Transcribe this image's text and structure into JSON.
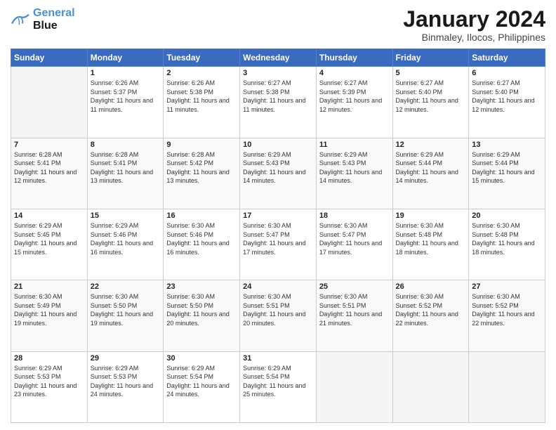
{
  "header": {
    "logo_line1": "General",
    "logo_line2": "Blue",
    "main_title": "January 2024",
    "subtitle": "Binmaley, Ilocos, Philippines"
  },
  "calendar": {
    "days_of_week": [
      "Sunday",
      "Monday",
      "Tuesday",
      "Wednesday",
      "Thursday",
      "Friday",
      "Saturday"
    ],
    "weeks": [
      [
        {
          "day": "",
          "empty": true
        },
        {
          "day": "1",
          "sunrise": "6:26 AM",
          "sunset": "5:37 PM",
          "daylight": "11 hours and 11 minutes."
        },
        {
          "day": "2",
          "sunrise": "6:26 AM",
          "sunset": "5:38 PM",
          "daylight": "11 hours and 11 minutes."
        },
        {
          "day": "3",
          "sunrise": "6:27 AM",
          "sunset": "5:38 PM",
          "daylight": "11 hours and 11 minutes."
        },
        {
          "day": "4",
          "sunrise": "6:27 AM",
          "sunset": "5:39 PM",
          "daylight": "11 hours and 12 minutes."
        },
        {
          "day": "5",
          "sunrise": "6:27 AM",
          "sunset": "5:40 PM",
          "daylight": "11 hours and 12 minutes."
        },
        {
          "day": "6",
          "sunrise": "6:27 AM",
          "sunset": "5:40 PM",
          "daylight": "11 hours and 12 minutes."
        }
      ],
      [
        {
          "day": "7",
          "sunrise": "6:28 AM",
          "sunset": "5:41 PM",
          "daylight": "11 hours and 12 minutes."
        },
        {
          "day": "8",
          "sunrise": "6:28 AM",
          "sunset": "5:41 PM",
          "daylight": "11 hours and 13 minutes."
        },
        {
          "day": "9",
          "sunrise": "6:28 AM",
          "sunset": "5:42 PM",
          "daylight": "11 hours and 13 minutes."
        },
        {
          "day": "10",
          "sunrise": "6:29 AM",
          "sunset": "5:43 PM",
          "daylight": "11 hours and 14 minutes."
        },
        {
          "day": "11",
          "sunrise": "6:29 AM",
          "sunset": "5:43 PM",
          "daylight": "11 hours and 14 minutes."
        },
        {
          "day": "12",
          "sunrise": "6:29 AM",
          "sunset": "5:44 PM",
          "daylight": "11 hours and 14 minutes."
        },
        {
          "day": "13",
          "sunrise": "6:29 AM",
          "sunset": "5:44 PM",
          "daylight": "11 hours and 15 minutes."
        }
      ],
      [
        {
          "day": "14",
          "sunrise": "6:29 AM",
          "sunset": "5:45 PM",
          "daylight": "11 hours and 15 minutes."
        },
        {
          "day": "15",
          "sunrise": "6:29 AM",
          "sunset": "5:46 PM",
          "daylight": "11 hours and 16 minutes."
        },
        {
          "day": "16",
          "sunrise": "6:30 AM",
          "sunset": "5:46 PM",
          "daylight": "11 hours and 16 minutes."
        },
        {
          "day": "17",
          "sunrise": "6:30 AM",
          "sunset": "5:47 PM",
          "daylight": "11 hours and 17 minutes."
        },
        {
          "day": "18",
          "sunrise": "6:30 AM",
          "sunset": "5:47 PM",
          "daylight": "11 hours and 17 minutes."
        },
        {
          "day": "19",
          "sunrise": "6:30 AM",
          "sunset": "5:48 PM",
          "daylight": "11 hours and 18 minutes."
        },
        {
          "day": "20",
          "sunrise": "6:30 AM",
          "sunset": "5:48 PM",
          "daylight": "11 hours and 18 minutes."
        }
      ],
      [
        {
          "day": "21",
          "sunrise": "6:30 AM",
          "sunset": "5:49 PM",
          "daylight": "11 hours and 19 minutes."
        },
        {
          "day": "22",
          "sunrise": "6:30 AM",
          "sunset": "5:50 PM",
          "daylight": "11 hours and 19 minutes."
        },
        {
          "day": "23",
          "sunrise": "6:30 AM",
          "sunset": "5:50 PM",
          "daylight": "11 hours and 20 minutes."
        },
        {
          "day": "24",
          "sunrise": "6:30 AM",
          "sunset": "5:51 PM",
          "daylight": "11 hours and 20 minutes."
        },
        {
          "day": "25",
          "sunrise": "6:30 AM",
          "sunset": "5:51 PM",
          "daylight": "11 hours and 21 minutes."
        },
        {
          "day": "26",
          "sunrise": "6:30 AM",
          "sunset": "5:52 PM",
          "daylight": "11 hours and 22 minutes."
        },
        {
          "day": "27",
          "sunrise": "6:30 AM",
          "sunset": "5:52 PM",
          "daylight": "11 hours and 22 minutes."
        }
      ],
      [
        {
          "day": "28",
          "sunrise": "6:29 AM",
          "sunset": "5:53 PM",
          "daylight": "11 hours and 23 minutes."
        },
        {
          "day": "29",
          "sunrise": "6:29 AM",
          "sunset": "5:53 PM",
          "daylight": "11 hours and 24 minutes."
        },
        {
          "day": "30",
          "sunrise": "6:29 AM",
          "sunset": "5:54 PM",
          "daylight": "11 hours and 24 minutes."
        },
        {
          "day": "31",
          "sunrise": "6:29 AM",
          "sunset": "5:54 PM",
          "daylight": "11 hours and 25 minutes."
        },
        {
          "day": "",
          "empty": true
        },
        {
          "day": "",
          "empty": true
        },
        {
          "day": "",
          "empty": true
        }
      ]
    ]
  }
}
